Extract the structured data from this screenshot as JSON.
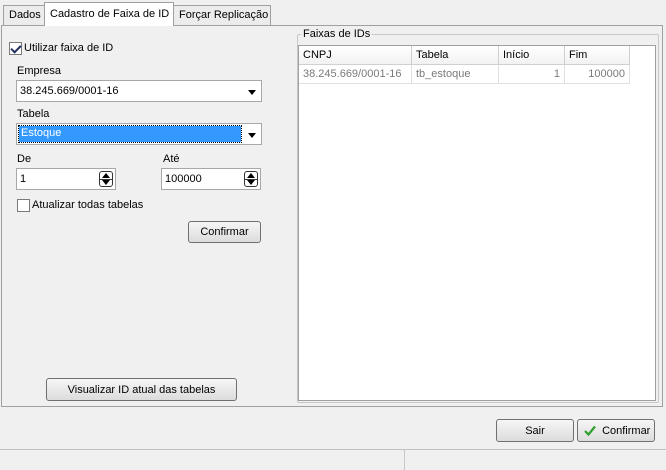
{
  "tabs": [
    {
      "label": "Dados"
    },
    {
      "label": "Cadastro de Faixa de ID"
    },
    {
      "label": "Forçar Replicação"
    }
  ],
  "form": {
    "use_range_label": "Utilizar faixa de ID",
    "use_range_checked": true,
    "empresa_label": "Empresa",
    "empresa_value": "38.245.669/0001-16",
    "tabela_label": "Tabela",
    "tabela_value": "Estoque",
    "de_label": "De",
    "de_value": "1",
    "ate_label": "Até",
    "ate_value": "100000",
    "update_all_label": "Atualizar todas tabelas",
    "update_all_checked": false,
    "confirm_label": "Confirmar",
    "view_ids_label": "Visualizar ID atual das tabelas"
  },
  "ranges": {
    "title": "Faixas de IDs",
    "columns": [
      "CNPJ",
      "Tabela",
      "Início",
      "Fim"
    ],
    "rows": [
      [
        "38.245.669/0001-16",
        "tb_estoque",
        "1",
        "100000"
      ]
    ]
  },
  "footer": {
    "exit_label": "Sair",
    "confirm_label": "Confirmar"
  },
  "colors": {
    "selection": "#3399ff",
    "confirm_check": "#2e9e2e"
  }
}
